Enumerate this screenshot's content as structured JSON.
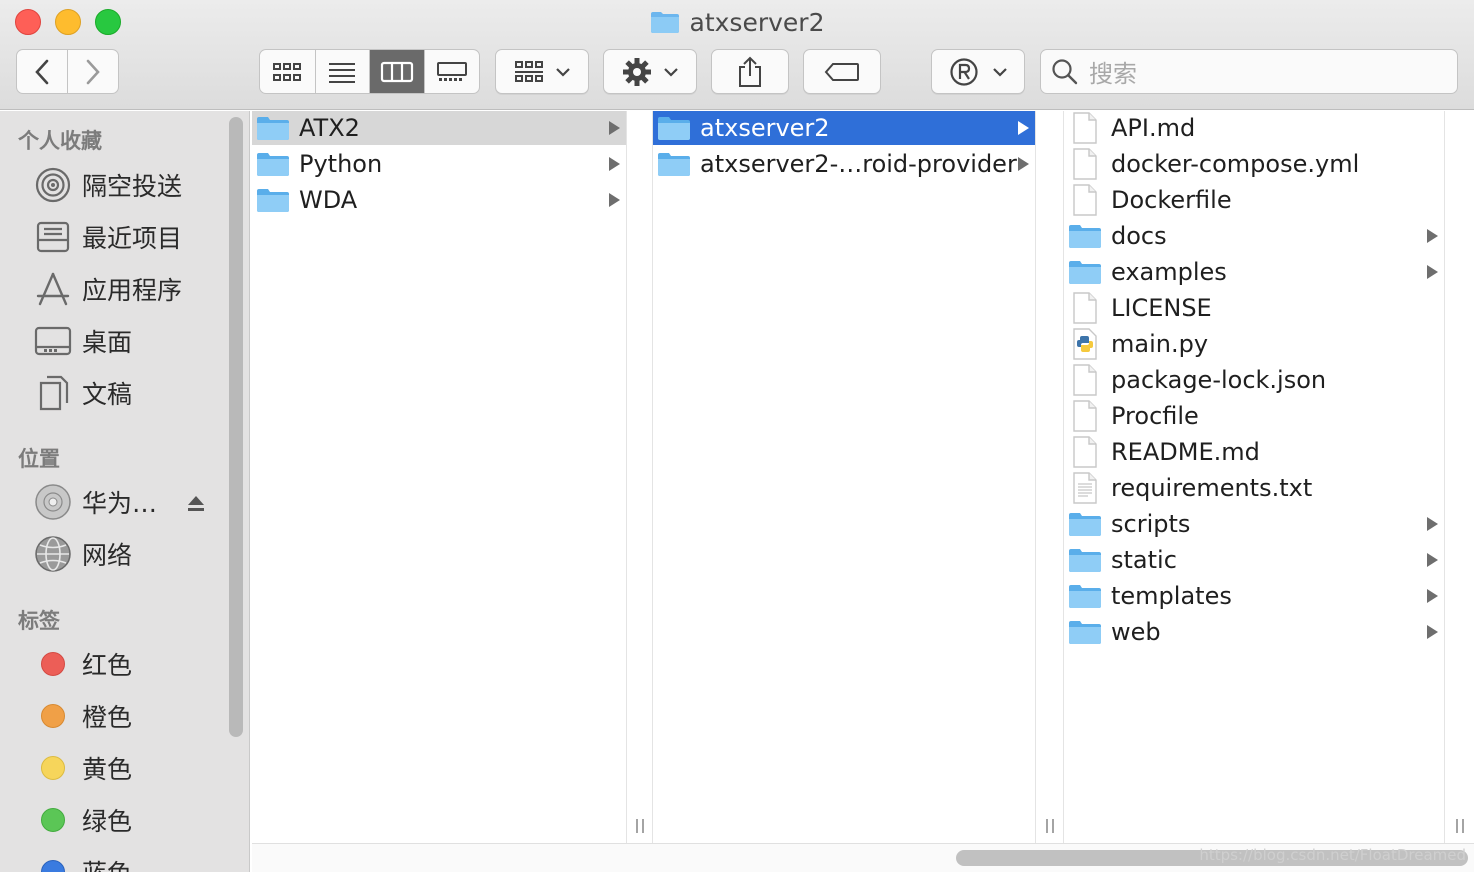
{
  "window": {
    "title": "atxserver2"
  },
  "toolbar": {
    "search_placeholder": "搜索"
  },
  "sidebar": {
    "favorites_header": "个人收藏",
    "favorites": [
      {
        "label": "隔空投送",
        "icon": "airdrop-icon"
      },
      {
        "label": "最近项目",
        "icon": "recents-icon"
      },
      {
        "label": "应用程序",
        "icon": "applications-icon"
      },
      {
        "label": "桌面",
        "icon": "desktop-icon"
      },
      {
        "label": "文稿",
        "icon": "documents-icon"
      }
    ],
    "locations_header": "位置",
    "locations": [
      {
        "label": "华为…",
        "icon": "disk-icon"
      },
      {
        "label": "网络",
        "icon": "network-icon"
      }
    ],
    "tags_header": "标签",
    "tags": [
      {
        "label": "红色",
        "color": "#ec5e57"
      },
      {
        "label": "橙色",
        "color": "#f0a047"
      },
      {
        "label": "黄色",
        "color": "#f6d55b"
      },
      {
        "label": "绿色",
        "color": "#5bc656"
      },
      {
        "label": "蓝色",
        "color": "#3a7be0"
      }
    ]
  },
  "columns": {
    "col1": [
      {
        "name": "ATX2",
        "type": "folder",
        "selected": "gray"
      },
      {
        "name": "Python",
        "type": "folder"
      },
      {
        "name": "WDA",
        "type": "folder"
      }
    ],
    "col2": [
      {
        "name": "atxserver2",
        "type": "folder",
        "selected": "blue"
      },
      {
        "name": "atxserver2-…roid-provider",
        "type": "folder"
      }
    ],
    "col3": [
      {
        "name": "API.md",
        "type": "file"
      },
      {
        "name": "docker-compose.yml",
        "type": "file"
      },
      {
        "name": "Dockerfile",
        "type": "file"
      },
      {
        "name": "docs",
        "type": "folder"
      },
      {
        "name": "examples",
        "type": "folder"
      },
      {
        "name": "LICENSE",
        "type": "file"
      },
      {
        "name": "main.py",
        "type": "python"
      },
      {
        "name": "package-lock.json",
        "type": "file"
      },
      {
        "name": "Procfile",
        "type": "file"
      },
      {
        "name": "README.md",
        "type": "file"
      },
      {
        "name": "requirements.txt",
        "type": "text"
      },
      {
        "name": "scripts",
        "type": "folder"
      },
      {
        "name": "static",
        "type": "folder"
      },
      {
        "name": "templates",
        "type": "folder"
      },
      {
        "name": "web",
        "type": "folder"
      }
    ]
  },
  "watermark": "https://blog.csdn.net/FloatDreamed"
}
